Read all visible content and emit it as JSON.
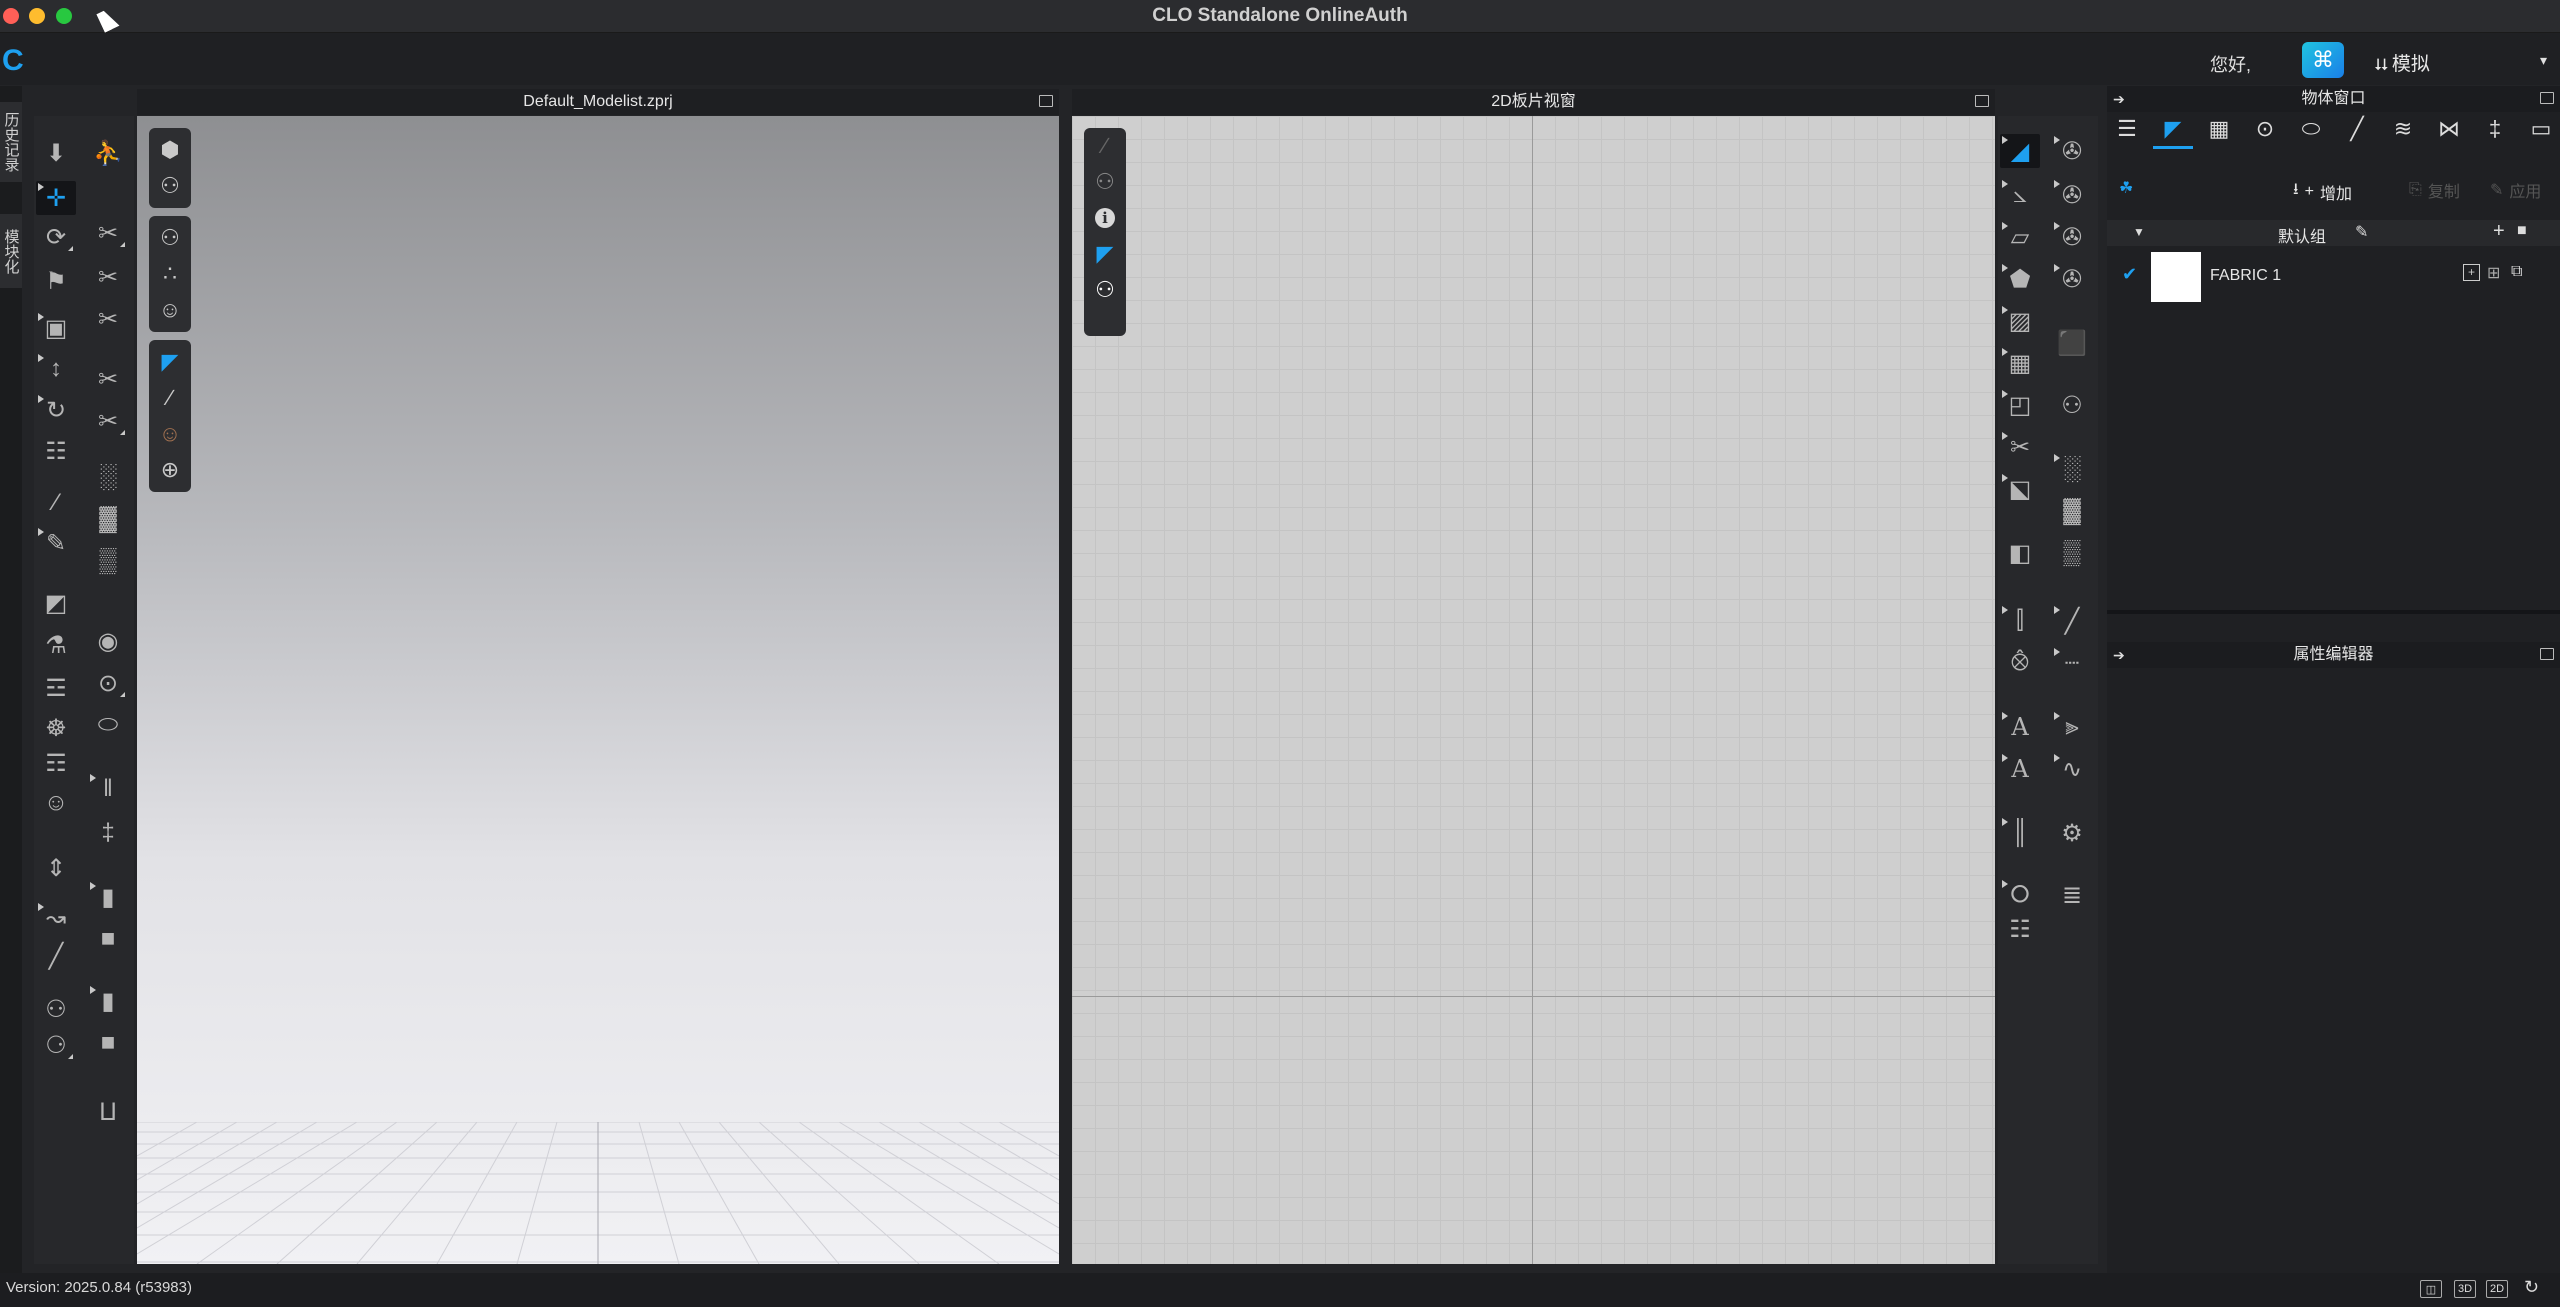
{
  "window": {
    "title": "CLO Standalone OnlineAuth",
    "traffic_colors": {
      "close": "#ff5f57",
      "minimize": "#febc2e",
      "zoom": "#28c840"
    }
  },
  "topbar": {
    "logo": "C",
    "greeting": "您好,",
    "mode": "模拟",
    "accent": "#1ea0f0"
  },
  "left_tabs": {
    "history": "历史记录",
    "modules": "模块化"
  },
  "viewport3d": {
    "title": "Default_Modelist.zprj"
  },
  "viewport2d": {
    "title": "2D板片视窗"
  },
  "object_browser": {
    "title": "物体窗口",
    "add_label": "增加",
    "copy_label": "复制",
    "apply_label": "应用",
    "group_name": "默认组",
    "fabrics": [
      {
        "name": "FABRIC 1",
        "checked": true
      }
    ]
  },
  "property_editor": {
    "title": "属性编辑器"
  },
  "statusbar": {
    "version": "Version: 2025.0.84 (r53983)",
    "view_3d": "3D",
    "view_2d": "2D"
  }
}
